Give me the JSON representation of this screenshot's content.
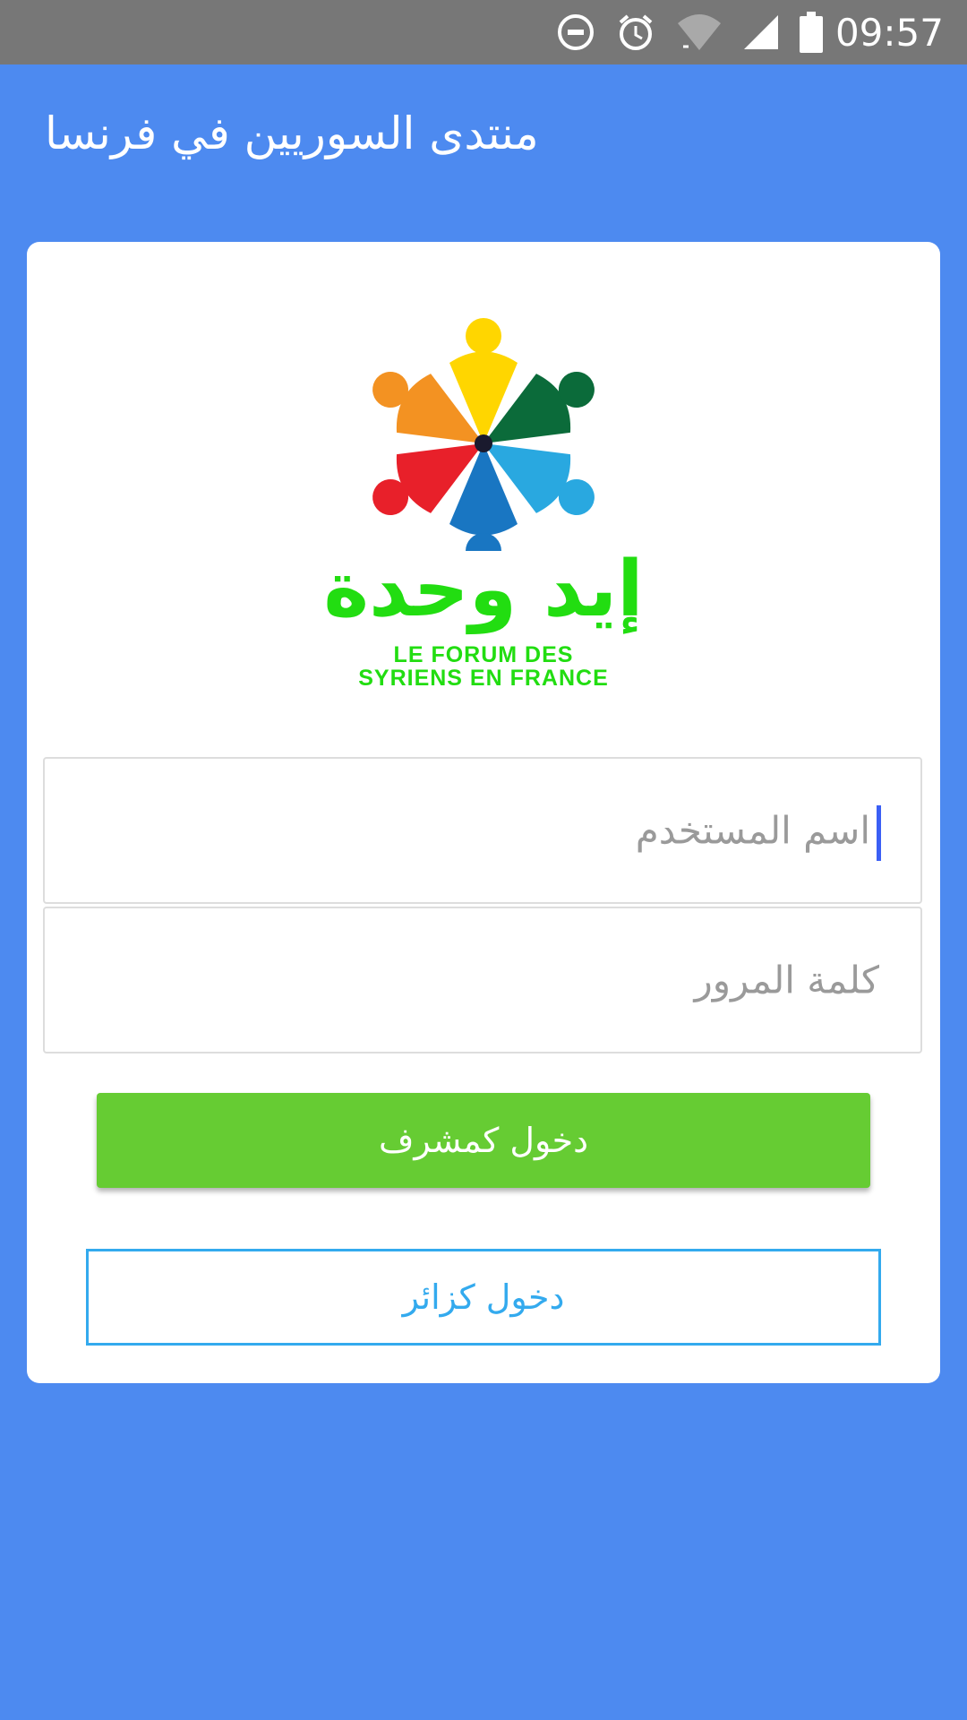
{
  "status_bar": {
    "time": "09:57",
    "icons": [
      "do-not-disturb-icon",
      "alarm-icon",
      "wifi-icon",
      "signal-icon",
      "battery-icon"
    ]
  },
  "app_bar": {
    "title": "منتدى السوريين في فرنسا"
  },
  "logo": {
    "arabic_text": "إيد وحدة",
    "line1": "LE FORUM DES",
    "line2": "SYRIENS EN FRANCE"
  },
  "form": {
    "username_placeholder": "اسم المستخدم",
    "password_placeholder": "كلمة المرور",
    "admin_login_label": "دخول كمشرف",
    "visitor_login_label": "دخول كزائر"
  },
  "colors": {
    "primary": "#4d8af0",
    "status_bar": "#777777",
    "admin_button": "#66cc33",
    "visitor_button_border": "#33aaee",
    "logo_text": "#22dd11"
  }
}
